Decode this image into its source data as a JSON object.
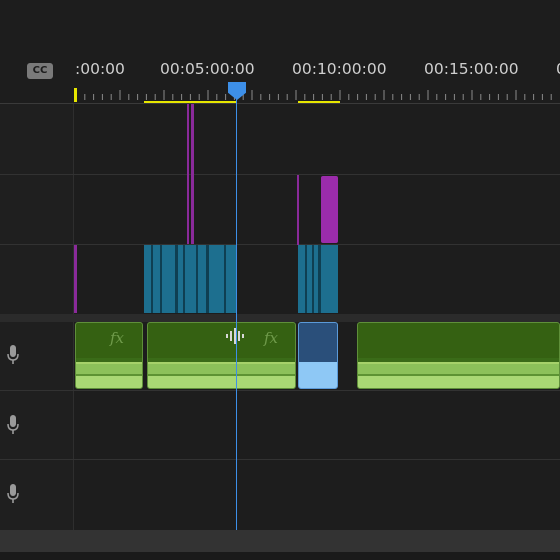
{
  "ruler": {
    "cc_label": "CC",
    "timecodes": [
      ":00:00",
      "00:05:00:00",
      "00:10:00:00",
      "00:15:00:00",
      "0"
    ]
  },
  "tracks": {
    "audio": [
      {
        "icon": "microphone-icon",
        "fx_labels": [
          "fx",
          "fx"
        ]
      },
      {
        "icon": "microphone-icon"
      },
      {
        "icon": "microphone-icon"
      }
    ]
  },
  "colors": {
    "playhead": "#3d8fe8",
    "video_clip_cyan": "#1d6f8f",
    "video_clip_purple": "#9b2cab",
    "audio_clip_green": "#356112",
    "in_out_marker": "#e6e600"
  }
}
